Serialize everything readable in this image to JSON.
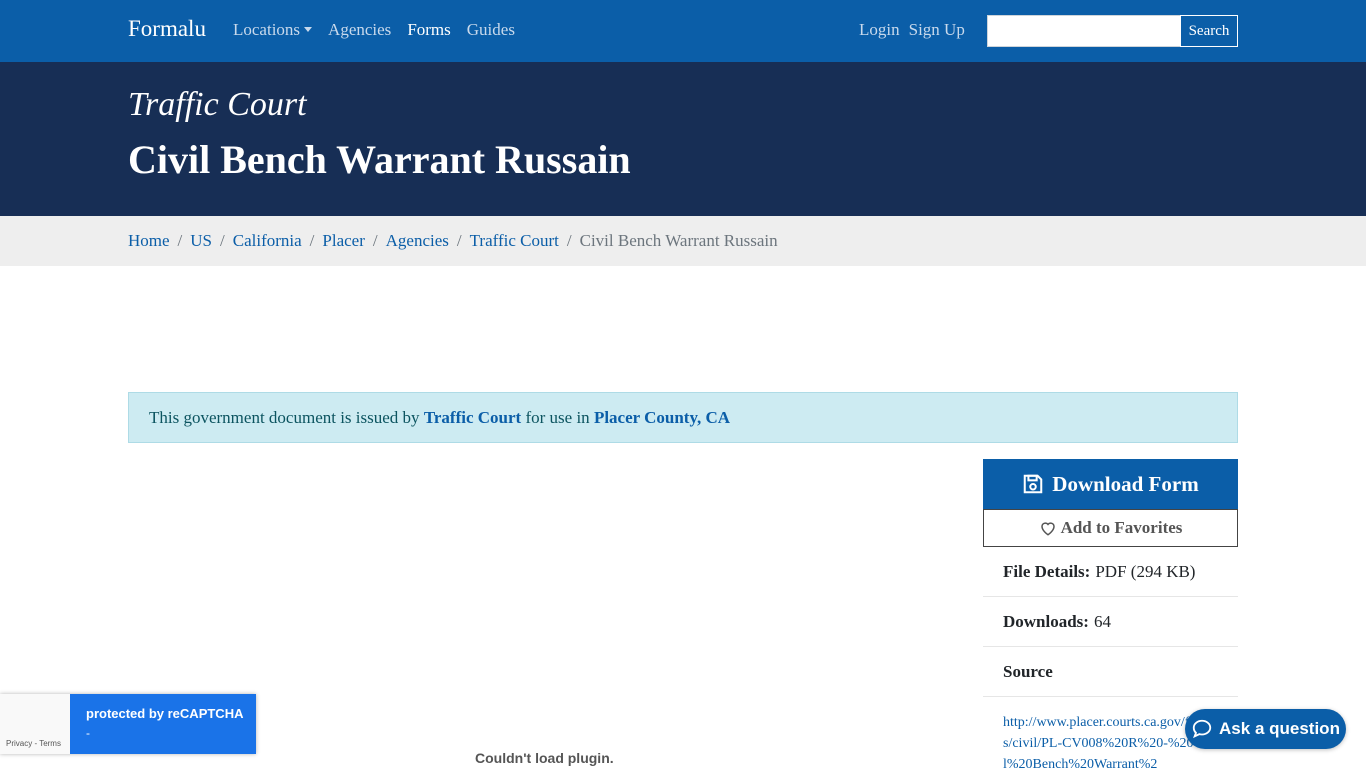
{
  "navbar": {
    "brand": "Formalu",
    "links": [
      "Locations",
      "Agencies",
      "Forms",
      "Guides"
    ],
    "auth": [
      "Login",
      "Sign Up"
    ],
    "search_placeholder": "",
    "search_button": "Search"
  },
  "hero": {
    "subtitle": "Traffic Court",
    "title": "Civil Bench Warrant Russain"
  },
  "breadcrumb": {
    "items": [
      "Home",
      "US",
      "California",
      "Placer",
      "Agencies",
      "Traffic Court"
    ],
    "current": "Civil Bench Warrant Russain",
    "separator": "/"
  },
  "alert": {
    "prefix": "This government document is issued by",
    "agency": "Traffic Court",
    "middle": "for use in",
    "location": "Placer County, CA"
  },
  "sidebar": {
    "download_label": "Download Form",
    "favorites_label": "Add to Favorites",
    "file_details_label": "File Details:",
    "file_details_value": "PDF (294 KB)",
    "downloads_label": "Downloads:",
    "downloads_value": "64",
    "source_label": "Source",
    "source_url": "http://www.placer.courts.ca.gov/forms/civil/PL-CV008%20R%20-%20Civil%20Bench%20Warrant%2"
  },
  "plugin_message": "Couldn't load plugin.",
  "recaptcha": {
    "text": "protected by reCAPTCHA",
    "dash": "-",
    "terms": "Privacy - Terms"
  },
  "ask_button": "Ask a question",
  "colors": {
    "brand_blue": "#0b5ea8",
    "hero_navy": "#172e55",
    "alert_bg": "#cdebf2"
  }
}
